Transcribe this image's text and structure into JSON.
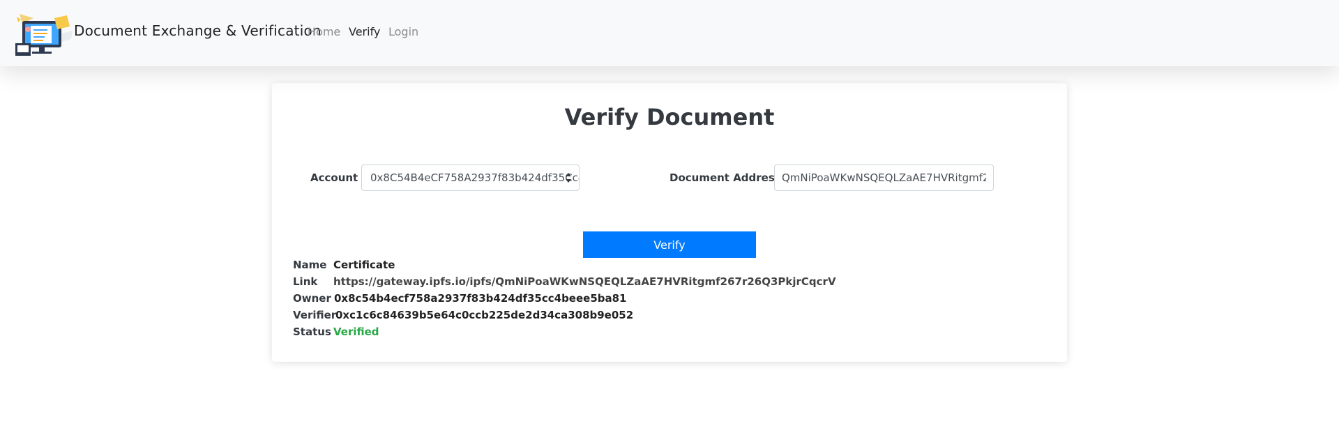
{
  "navbar": {
    "brand": "Document Exchange & Verification",
    "links": [
      {
        "label": "Home",
        "active": false
      },
      {
        "label": "Verify",
        "active": true
      },
      {
        "label": "Login",
        "active": false
      }
    ]
  },
  "card": {
    "title": "Verify Document",
    "account": {
      "label": "Account",
      "selected": "0x8C54B4eCF758A2937f83b424df35Cc4beee5ba81"
    },
    "document_address": {
      "label": "Document Address",
      "value": "QmNiPoaWKwNSQEQLZaAE7HVRitgmf267r26Q3PkjrCqcrV"
    },
    "verify_button": "Verify",
    "details": [
      {
        "key": "Name",
        "value": "Certificate"
      },
      {
        "key": "Link",
        "value": "https://gateway.ipfs.io/ipfs/QmNiPoaWKwNSQEQLZaAE7HVRitgmf267r26Q3PkjrCqcrV"
      },
      {
        "key": "Owner",
        "value": "0x8c54b4ecf758a2937f83b424df35cc4beee5ba81"
      },
      {
        "key": "Verifier",
        "value": "0xc1c6c84639b5e64c0ccb225de2d34ca308b9e052"
      },
      {
        "key": "Status",
        "value": "Verified"
      }
    ]
  },
  "colors": {
    "primary": "#007bff",
    "success": "#28a745",
    "navbar_bg": "#f8f9fa"
  }
}
